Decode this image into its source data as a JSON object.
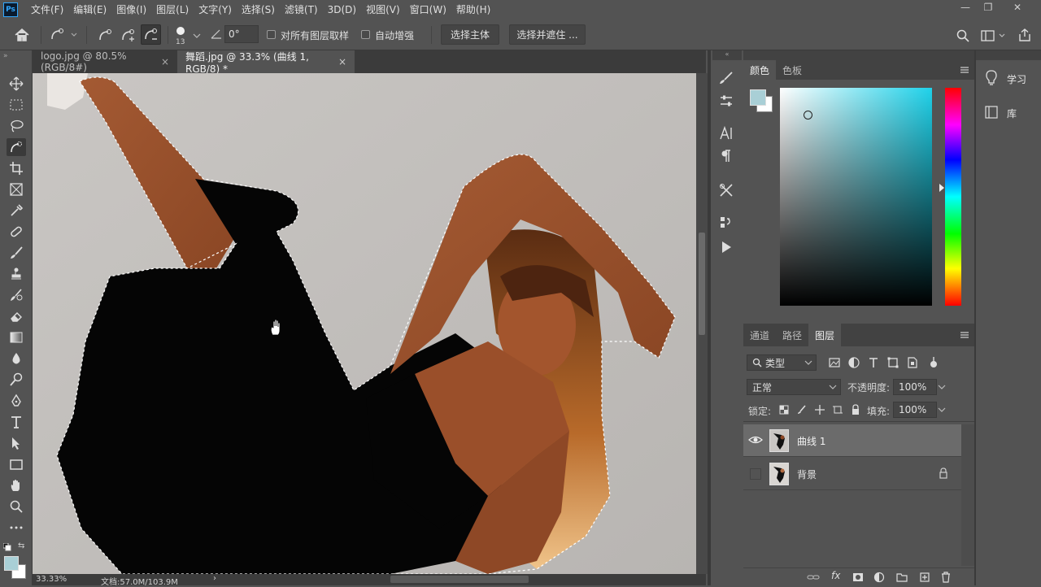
{
  "app": {
    "logo": "Ps"
  },
  "menu": [
    "文件(F)",
    "编辑(E)",
    "图像(I)",
    "图层(L)",
    "文字(Y)",
    "选择(S)",
    "滤镜(T)",
    "3D(D)",
    "视图(V)",
    "窗口(W)",
    "帮助(H)"
  ],
  "window_controls": {
    "minimize": "—",
    "restore": "❐",
    "close": "✕"
  },
  "options": {
    "brush_size": "13",
    "angle": "0°",
    "sample_all_layers": "对所有图层取样",
    "auto_enhance": "自动增强",
    "select_subject": "选择主体",
    "select_and_mask": "选择并遮住 ..."
  },
  "tabs": [
    {
      "label": "logo.jpg @ 80.5%(RGB/8#)",
      "close": "×"
    },
    {
      "label": "舞蹈.jpg @ 33.3% (曲线 1, RGB/8) *",
      "close": "×"
    }
  ],
  "status": {
    "zoom": "33.33%",
    "doc": "文档:57.0M/103.9M",
    "arrow": "›"
  },
  "color_panel": {
    "tabs": [
      "颜色",
      "色板"
    ],
    "fg_color": "#a9cfd6",
    "bg_color": "#ffffff",
    "hue_color": "#1fd2ea"
  },
  "layers_panel": {
    "tabs": [
      "通道",
      "路径",
      "图层"
    ],
    "filter_kind": "类型",
    "blend_mode": "正常",
    "opacity_label": "不透明度:",
    "opacity": "100%",
    "lock_label": "锁定:",
    "fill_label": "填充:",
    "fill": "100%",
    "layers": [
      {
        "name": "曲线 1",
        "visible": true,
        "selected": true
      },
      {
        "name": "背景",
        "visible": false,
        "selected": false
      }
    ]
  },
  "learn_panel": {
    "items": [
      "学习",
      "库"
    ]
  }
}
